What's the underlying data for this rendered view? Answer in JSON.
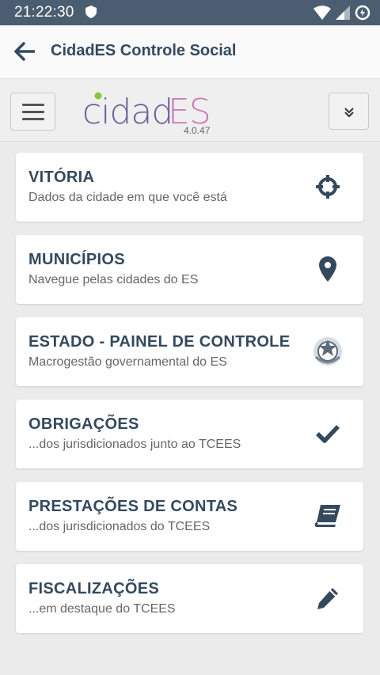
{
  "status_bar": {
    "time": "21:22:30"
  },
  "app_bar": {
    "title": "CidadES Controle Social"
  },
  "logo": {
    "text": "cidadES",
    "version": "4.0.47"
  },
  "cards": [
    {
      "title": "VITÓRIA",
      "subtitle": "Dados da cidade em que você está",
      "icon": "crosshairs-icon"
    },
    {
      "title": "MUNICÍPIOS",
      "subtitle": "Navegue pelas cidades do ES",
      "icon": "map-marker-icon"
    },
    {
      "title": "ESTADO - PAINEL DE CONTROLE",
      "subtitle": "Macrogestão governamental do ES",
      "icon": "state-seal-icon"
    },
    {
      "title": "OBRIGAÇÕES",
      "subtitle": "...dos jurisdicionados junto ao TCEES",
      "icon": "checkmark-icon"
    },
    {
      "title": "PRESTAÇÕES DE CONTAS",
      "subtitle": "...dos jurisdicionados do TCEES",
      "icon": "book-icon"
    },
    {
      "title": "FISCALIZAÇÕES",
      "subtitle": "...em destaque do TCEES",
      "icon": "pencil-icon"
    }
  ],
  "colors": {
    "status_bar": "#4b5d70",
    "title": "#34495e",
    "background": "#ebebeb",
    "logo_purple": "#6b5d9a",
    "logo_pink": "#c97ab4",
    "logo_green": "#8cc63f"
  }
}
